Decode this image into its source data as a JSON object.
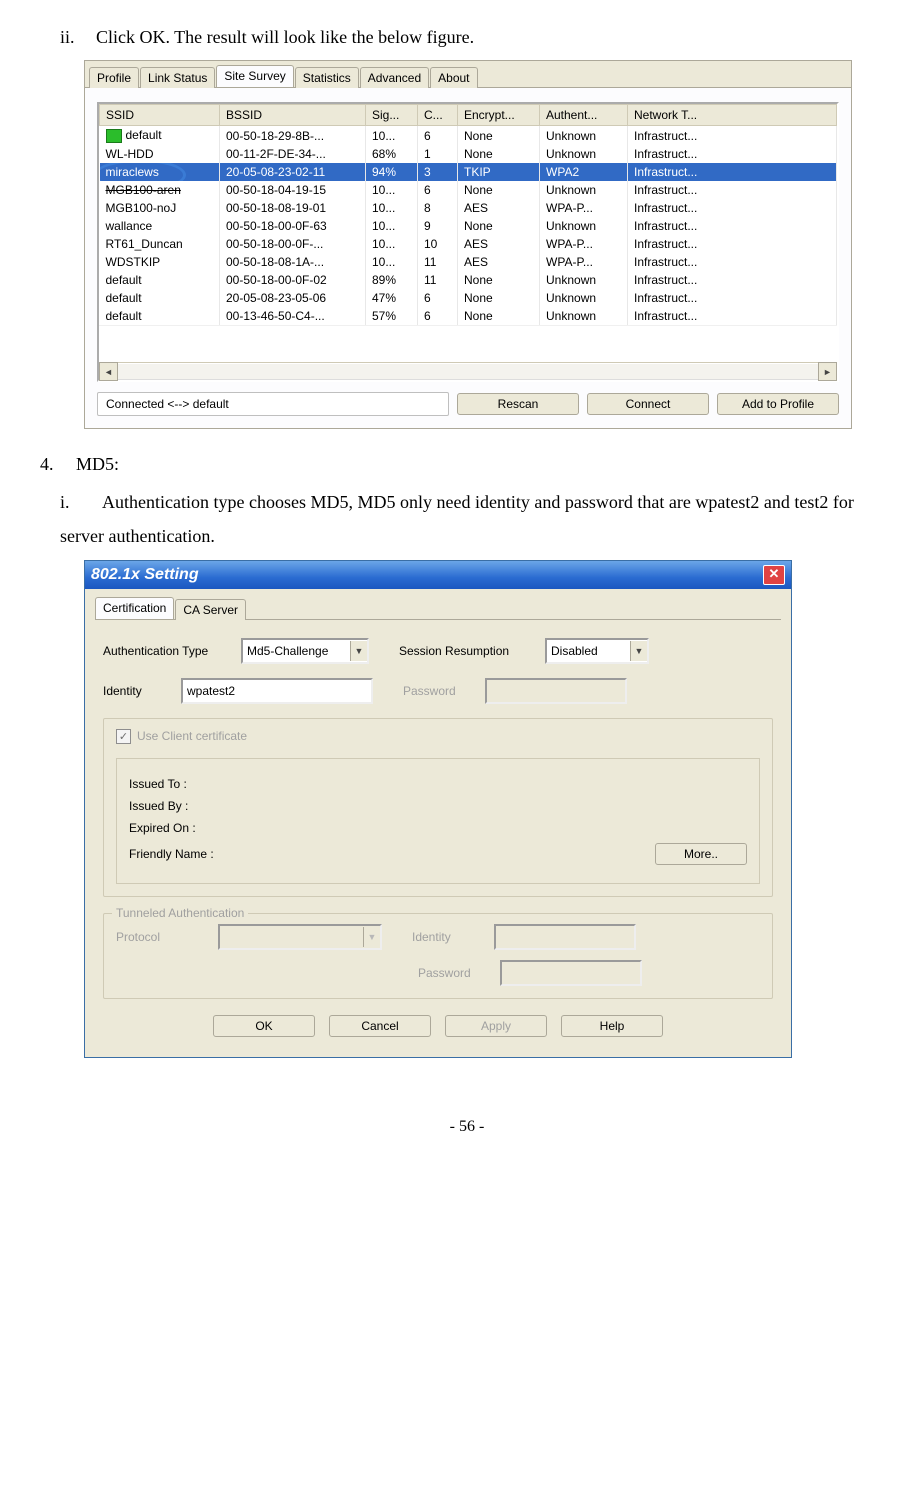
{
  "doc": {
    "step_ii": "Click OK. The result will look like the below figure.",
    "step4_num": "4.",
    "step4_label": "MD5:",
    "step_i_num": "i.",
    "step_i_text": "Authentication type chooses MD5, MD5 only need identity and password that are wpatest2 and test2 for server authentication.",
    "page_num": "- 56 -"
  },
  "survey": {
    "tabs": [
      "Profile",
      "Link Status",
      "Site Survey",
      "Statistics",
      "Advanced",
      "About"
    ],
    "cols": [
      "SSID",
      "BSSID",
      "Sig...",
      "C...",
      "Encrypt...",
      "Authent...",
      "Network T..."
    ],
    "rows": [
      {
        "ssid": "default",
        "bssid": "00-50-18-29-8B-...",
        "sig": "10...",
        "ch": "6",
        "enc": "None",
        "auth": "Unknown",
        "nt": "Infrastruct...",
        "icon": true
      },
      {
        "ssid": "WL-HDD",
        "bssid": "00-11-2F-DE-34-...",
        "sig": "68%",
        "ch": "1",
        "enc": "None",
        "auth": "Unknown",
        "nt": "Infrastruct..."
      },
      {
        "ssid": "miraclews",
        "bssid": "20-05-08-23-02-11",
        "sig": "94%",
        "ch": "3",
        "enc": "TKIP",
        "auth": "WPA2",
        "nt": "Infrastruct...",
        "selected": true,
        "circled": true
      },
      {
        "ssid": "MGB100-aren",
        "bssid": "00-50-18-04-19-15",
        "sig": "10...",
        "ch": "6",
        "enc": "None",
        "auth": "Unknown",
        "nt": "Infrastruct...",
        "struck": true
      },
      {
        "ssid": "MGB100-noJ",
        "bssid": "00-50-18-08-19-01",
        "sig": "10...",
        "ch": "8",
        "enc": "AES",
        "auth": "WPA-P...",
        "nt": "Infrastruct..."
      },
      {
        "ssid": "wallance",
        "bssid": "00-50-18-00-0F-63",
        "sig": "10...",
        "ch": "9",
        "enc": "None",
        "auth": "Unknown",
        "nt": "Infrastruct..."
      },
      {
        "ssid": "RT61_Duncan",
        "bssid": "00-50-18-00-0F-...",
        "sig": "10...",
        "ch": "10",
        "enc": "AES",
        "auth": "WPA-P...",
        "nt": "Infrastruct..."
      },
      {
        "ssid": "WDSTKIP",
        "bssid": "00-50-18-08-1A-...",
        "sig": "10...",
        "ch": "11",
        "enc": "AES",
        "auth": "WPA-P...",
        "nt": "Infrastruct..."
      },
      {
        "ssid": "default",
        "bssid": "00-50-18-00-0F-02",
        "sig": "89%",
        "ch": "11",
        "enc": "None",
        "auth": "Unknown",
        "nt": "Infrastruct..."
      },
      {
        "ssid": "default",
        "bssid": "20-05-08-23-05-06",
        "sig": "47%",
        "ch": "6",
        "enc": "None",
        "auth": "Unknown",
        "nt": "Infrastruct..."
      },
      {
        "ssid": "default",
        "bssid": "00-13-46-50-C4-...",
        "sig": "57%",
        "ch": "6",
        "enc": "None",
        "auth": "Unknown",
        "nt": "Infrastruct..."
      }
    ],
    "status": "Connected <--> default",
    "btn_rescan": "Rescan",
    "btn_connect": "Connect",
    "btn_add": "Add to Profile"
  },
  "dlg": {
    "title": "802.1x Setting",
    "tabs": [
      "Certification",
      "CA Server"
    ],
    "auth_type_lbl": "Authentication Type",
    "auth_type_val": "Md5-Challenge",
    "session_lbl": "Session Resumption",
    "session_val": "Disabled",
    "identity_lbl": "Identity",
    "identity_val": "wpatest2",
    "password_lbl": "Password",
    "use_client_cert": "Use Client certificate",
    "issued_to": "Issued To :",
    "issued_by": "Issued By :",
    "expired_on": "Expired On :",
    "friendly": "Friendly Name :",
    "more": "More..",
    "tunnel_legend": "Tunneled Authentication",
    "protocol_lbl": "Protocol",
    "tun_identity_lbl": "Identity",
    "tun_password_lbl": "Password",
    "ok": "OK",
    "cancel": "Cancel",
    "apply": "Apply",
    "help": "Help"
  }
}
